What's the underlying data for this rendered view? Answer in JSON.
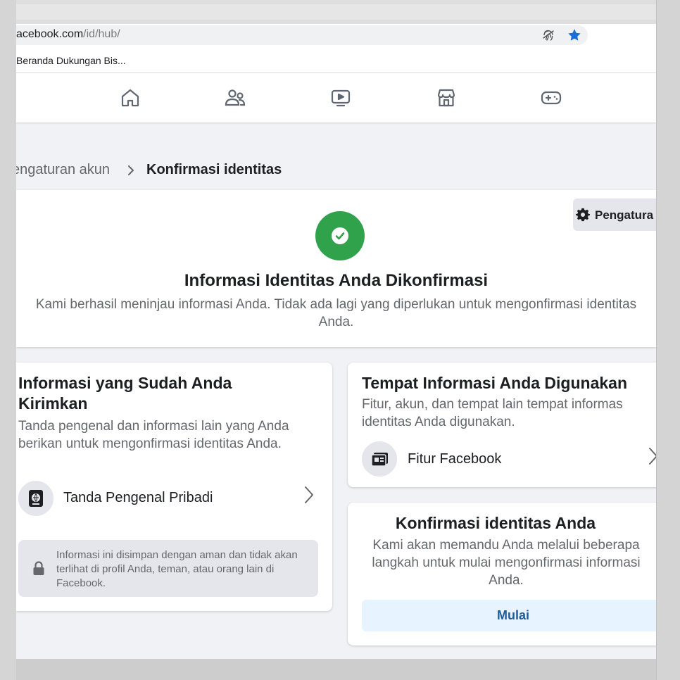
{
  "browser": {
    "url_host": "acebook.com",
    "url_path": "/id/hub/",
    "bookmark_label": "Beranda Dukungan Bis..."
  },
  "nav": {
    "icons": [
      "home-icon",
      "friends-icon",
      "video-icon",
      "marketplace-icon",
      "gaming-icon"
    ]
  },
  "breadcrumb": {
    "previous": "engaturan akun",
    "current": "Konfirmasi identitas"
  },
  "hero": {
    "settings_label": "Pengatura",
    "title": "Informasi Identitas Anda Dikonfirmasi",
    "subtitle": "Kami berhasil meninjau informasi Anda. Tidak ada lagi yang diperlukan untuk mengonfirmasi identitas Anda.",
    "success_color": "#31a24c"
  },
  "submitted": {
    "title": "Informasi yang Sudah Anda Kirimkan",
    "description": "Tanda pengenal dan informasi lain yang Anda berikan untuk mengonfirmasi identitas Anda.",
    "item_label": "Tanda Pengenal Pribadi",
    "privacy_note": "Informasi ini disimpan dengan aman dan tidak akan terlihat di profil Anda, teman, atau orang lain di Facebook."
  },
  "usage": {
    "title": "Tempat Informasi Anda Digunakan",
    "description": "Fitur, akun, dan tempat lain tempat informas identitas Anda digunakan.",
    "item_label": "Fitur Facebook"
  },
  "confirm": {
    "title": "Konfirmasi identitas Anda",
    "description": "Kami akan memandu Anda melalui beberapa langkah untuk mulai mengonfirmasi informasi Anda.",
    "button_label": "Mulai",
    "button_color": "#1e5c9b"
  }
}
